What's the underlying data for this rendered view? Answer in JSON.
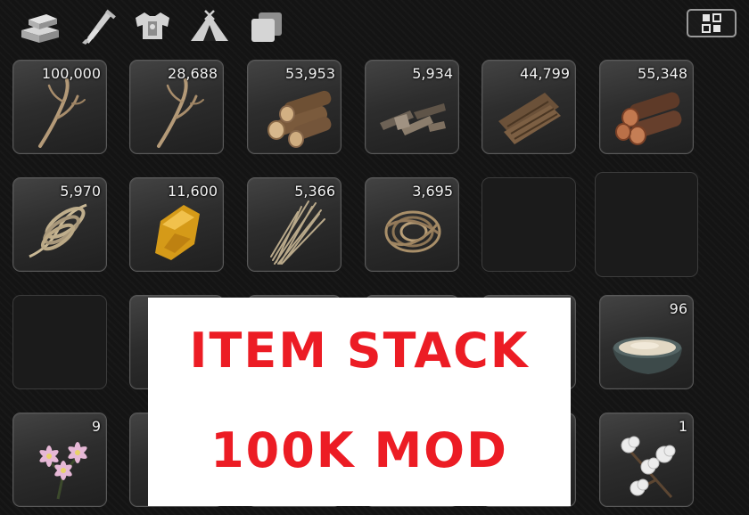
{
  "toolbar": {
    "tabs": [
      {
        "icon": "materials-stack-icon"
      },
      {
        "icon": "weapon-sword-icon"
      },
      {
        "icon": "armor-chest-icon"
      },
      {
        "icon": "camp-tent-icon"
      },
      {
        "icon": "storage-pages-icon"
      }
    ],
    "expand_icon": "expand-window-icon"
  },
  "inventory": {
    "slots": [
      {
        "item": "branch",
        "count": "100,000"
      },
      {
        "item": "branch",
        "count": "28,688"
      },
      {
        "item": "logs",
        "count": "53,953"
      },
      {
        "item": "wood-scraps",
        "count": "5,934"
      },
      {
        "item": "bark",
        "count": "44,799"
      },
      {
        "item": "red-logs",
        "count": "55,348"
      },
      {
        "item": "rope-coil",
        "count": "5,970"
      },
      {
        "item": "amber-resin",
        "count": "11,600"
      },
      {
        "item": "dry-grass",
        "count": "5,366"
      },
      {
        "item": "vine-bundle",
        "count": "3,695"
      },
      {
        "item": "empty",
        "count": ""
      },
      {
        "item": "empty",
        "count": ""
      },
      {
        "item": "empty",
        "count": ""
      },
      {
        "item": "empty",
        "count": ""
      },
      {
        "item": "hidden",
        "count": ""
      },
      {
        "item": "hidden",
        "count": ""
      },
      {
        "item": "hidden",
        "count": ""
      },
      {
        "item": "paste-bowl",
        "count": "96"
      },
      {
        "item": "flowers",
        "count": "9"
      },
      {
        "item": "hidden",
        "count": ""
      },
      {
        "item": "hidden",
        "count": ""
      },
      {
        "item": "hidden",
        "count": ""
      },
      {
        "item": "hidden",
        "count": ""
      },
      {
        "item": "cotton",
        "count": "1"
      }
    ]
  },
  "banner": {
    "line1": "ITEM STACK",
    "line2": "100K MOD",
    "color": "#ec1c24"
  }
}
